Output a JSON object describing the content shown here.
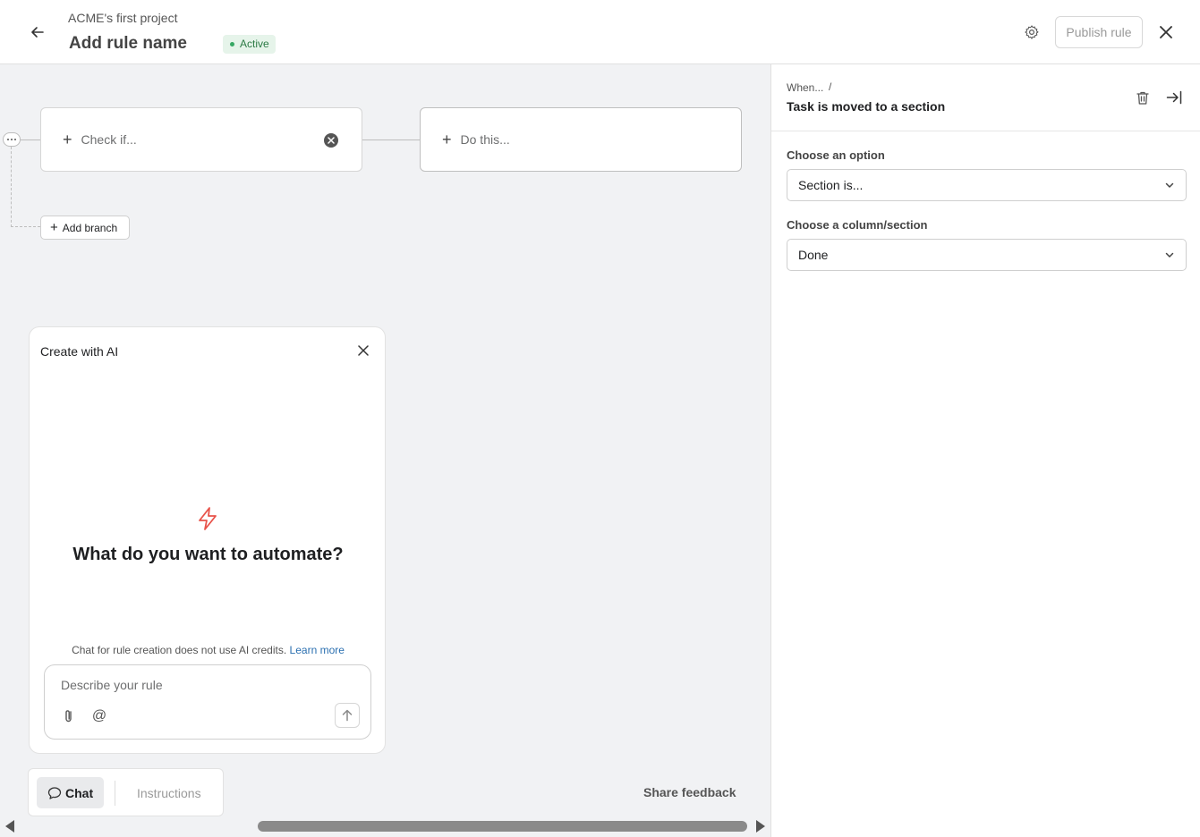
{
  "header": {
    "project_name": "ACME's first project",
    "rule_name": "Add rule name",
    "status": "Active",
    "publish_label": "Publish rule"
  },
  "canvas": {
    "check_label": "Check if...",
    "do_label": "Do this...",
    "add_branch_label": "Add branch"
  },
  "ai_panel": {
    "title": "Create with AI",
    "heading": "What do you want to automate?",
    "note": "Chat for rule creation does not use AI credits.",
    "learn_more": "Learn more",
    "input_placeholder": "Describe your rule"
  },
  "tabs": {
    "chat": "Chat",
    "instructions": "Instructions",
    "share_feedback": "Share feedback"
  },
  "side_panel": {
    "breadcrumb_when": "When...",
    "breadcrumb_sep": "/",
    "trigger_title": "Task is moved to a section",
    "option_label": "Choose an option",
    "option_value": "Section is...",
    "section_label": "Choose a column/section",
    "section_value": "Done"
  },
  "colors": {
    "accent_active": "#37a864",
    "link": "#2a6fb0",
    "bolt": "#e8534a",
    "canvas_bg": "#f1f2f4"
  }
}
